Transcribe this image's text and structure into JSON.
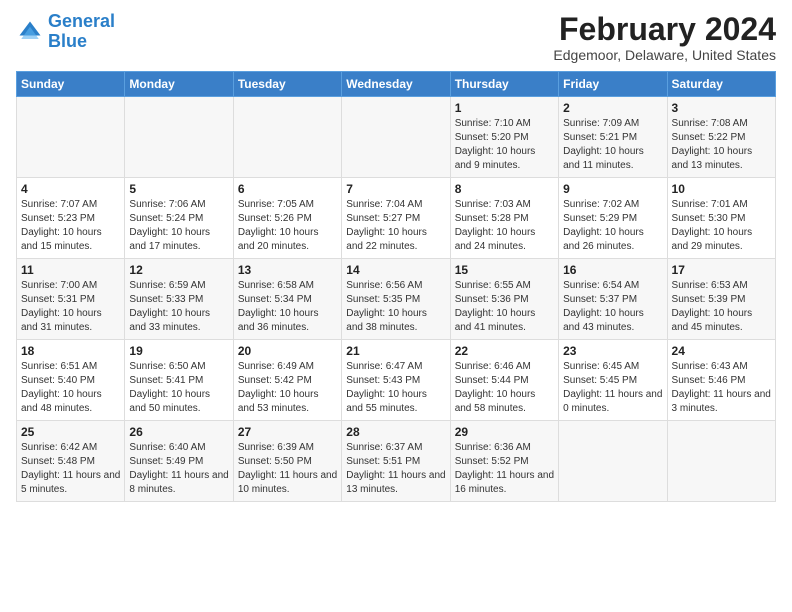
{
  "logo": {
    "text_general": "General",
    "text_blue": "Blue"
  },
  "title": "February 2024",
  "subtitle": "Edgemoor, Delaware, United States",
  "days_of_week": [
    "Sunday",
    "Monday",
    "Tuesday",
    "Wednesday",
    "Thursday",
    "Friday",
    "Saturday"
  ],
  "weeks": [
    [
      {
        "num": "",
        "sunrise": "",
        "sunset": "",
        "daylight": ""
      },
      {
        "num": "",
        "sunrise": "",
        "sunset": "",
        "daylight": ""
      },
      {
        "num": "",
        "sunrise": "",
        "sunset": "",
        "daylight": ""
      },
      {
        "num": "",
        "sunrise": "",
        "sunset": "",
        "daylight": ""
      },
      {
        "num": "1",
        "sunrise": "Sunrise: 7:10 AM",
        "sunset": "Sunset: 5:20 PM",
        "daylight": "Daylight: 10 hours and 9 minutes."
      },
      {
        "num": "2",
        "sunrise": "Sunrise: 7:09 AM",
        "sunset": "Sunset: 5:21 PM",
        "daylight": "Daylight: 10 hours and 11 minutes."
      },
      {
        "num": "3",
        "sunrise": "Sunrise: 7:08 AM",
        "sunset": "Sunset: 5:22 PM",
        "daylight": "Daylight: 10 hours and 13 minutes."
      }
    ],
    [
      {
        "num": "4",
        "sunrise": "Sunrise: 7:07 AM",
        "sunset": "Sunset: 5:23 PM",
        "daylight": "Daylight: 10 hours and 15 minutes."
      },
      {
        "num": "5",
        "sunrise": "Sunrise: 7:06 AM",
        "sunset": "Sunset: 5:24 PM",
        "daylight": "Daylight: 10 hours and 17 minutes."
      },
      {
        "num": "6",
        "sunrise": "Sunrise: 7:05 AM",
        "sunset": "Sunset: 5:26 PM",
        "daylight": "Daylight: 10 hours and 20 minutes."
      },
      {
        "num": "7",
        "sunrise": "Sunrise: 7:04 AM",
        "sunset": "Sunset: 5:27 PM",
        "daylight": "Daylight: 10 hours and 22 minutes."
      },
      {
        "num": "8",
        "sunrise": "Sunrise: 7:03 AM",
        "sunset": "Sunset: 5:28 PM",
        "daylight": "Daylight: 10 hours and 24 minutes."
      },
      {
        "num": "9",
        "sunrise": "Sunrise: 7:02 AM",
        "sunset": "Sunset: 5:29 PM",
        "daylight": "Daylight: 10 hours and 26 minutes."
      },
      {
        "num": "10",
        "sunrise": "Sunrise: 7:01 AM",
        "sunset": "Sunset: 5:30 PM",
        "daylight": "Daylight: 10 hours and 29 minutes."
      }
    ],
    [
      {
        "num": "11",
        "sunrise": "Sunrise: 7:00 AM",
        "sunset": "Sunset: 5:31 PM",
        "daylight": "Daylight: 10 hours and 31 minutes."
      },
      {
        "num": "12",
        "sunrise": "Sunrise: 6:59 AM",
        "sunset": "Sunset: 5:33 PM",
        "daylight": "Daylight: 10 hours and 33 minutes."
      },
      {
        "num": "13",
        "sunrise": "Sunrise: 6:58 AM",
        "sunset": "Sunset: 5:34 PM",
        "daylight": "Daylight: 10 hours and 36 minutes."
      },
      {
        "num": "14",
        "sunrise": "Sunrise: 6:56 AM",
        "sunset": "Sunset: 5:35 PM",
        "daylight": "Daylight: 10 hours and 38 minutes."
      },
      {
        "num": "15",
        "sunrise": "Sunrise: 6:55 AM",
        "sunset": "Sunset: 5:36 PM",
        "daylight": "Daylight: 10 hours and 41 minutes."
      },
      {
        "num": "16",
        "sunrise": "Sunrise: 6:54 AM",
        "sunset": "Sunset: 5:37 PM",
        "daylight": "Daylight: 10 hours and 43 minutes."
      },
      {
        "num": "17",
        "sunrise": "Sunrise: 6:53 AM",
        "sunset": "Sunset: 5:39 PM",
        "daylight": "Daylight: 10 hours and 45 minutes."
      }
    ],
    [
      {
        "num": "18",
        "sunrise": "Sunrise: 6:51 AM",
        "sunset": "Sunset: 5:40 PM",
        "daylight": "Daylight: 10 hours and 48 minutes."
      },
      {
        "num": "19",
        "sunrise": "Sunrise: 6:50 AM",
        "sunset": "Sunset: 5:41 PM",
        "daylight": "Daylight: 10 hours and 50 minutes."
      },
      {
        "num": "20",
        "sunrise": "Sunrise: 6:49 AM",
        "sunset": "Sunset: 5:42 PM",
        "daylight": "Daylight: 10 hours and 53 minutes."
      },
      {
        "num": "21",
        "sunrise": "Sunrise: 6:47 AM",
        "sunset": "Sunset: 5:43 PM",
        "daylight": "Daylight: 10 hours and 55 minutes."
      },
      {
        "num": "22",
        "sunrise": "Sunrise: 6:46 AM",
        "sunset": "Sunset: 5:44 PM",
        "daylight": "Daylight: 10 hours and 58 minutes."
      },
      {
        "num": "23",
        "sunrise": "Sunrise: 6:45 AM",
        "sunset": "Sunset: 5:45 PM",
        "daylight": "Daylight: 11 hours and 0 minutes."
      },
      {
        "num": "24",
        "sunrise": "Sunrise: 6:43 AM",
        "sunset": "Sunset: 5:46 PM",
        "daylight": "Daylight: 11 hours and 3 minutes."
      }
    ],
    [
      {
        "num": "25",
        "sunrise": "Sunrise: 6:42 AM",
        "sunset": "Sunset: 5:48 PM",
        "daylight": "Daylight: 11 hours and 5 minutes."
      },
      {
        "num": "26",
        "sunrise": "Sunrise: 6:40 AM",
        "sunset": "Sunset: 5:49 PM",
        "daylight": "Daylight: 11 hours and 8 minutes."
      },
      {
        "num": "27",
        "sunrise": "Sunrise: 6:39 AM",
        "sunset": "Sunset: 5:50 PM",
        "daylight": "Daylight: 11 hours and 10 minutes."
      },
      {
        "num": "28",
        "sunrise": "Sunrise: 6:37 AM",
        "sunset": "Sunset: 5:51 PM",
        "daylight": "Daylight: 11 hours and 13 minutes."
      },
      {
        "num": "29",
        "sunrise": "Sunrise: 6:36 AM",
        "sunset": "Sunset: 5:52 PM",
        "daylight": "Daylight: 11 hours and 16 minutes."
      },
      {
        "num": "",
        "sunrise": "",
        "sunset": "",
        "daylight": ""
      },
      {
        "num": "",
        "sunrise": "",
        "sunset": "",
        "daylight": ""
      }
    ]
  ]
}
